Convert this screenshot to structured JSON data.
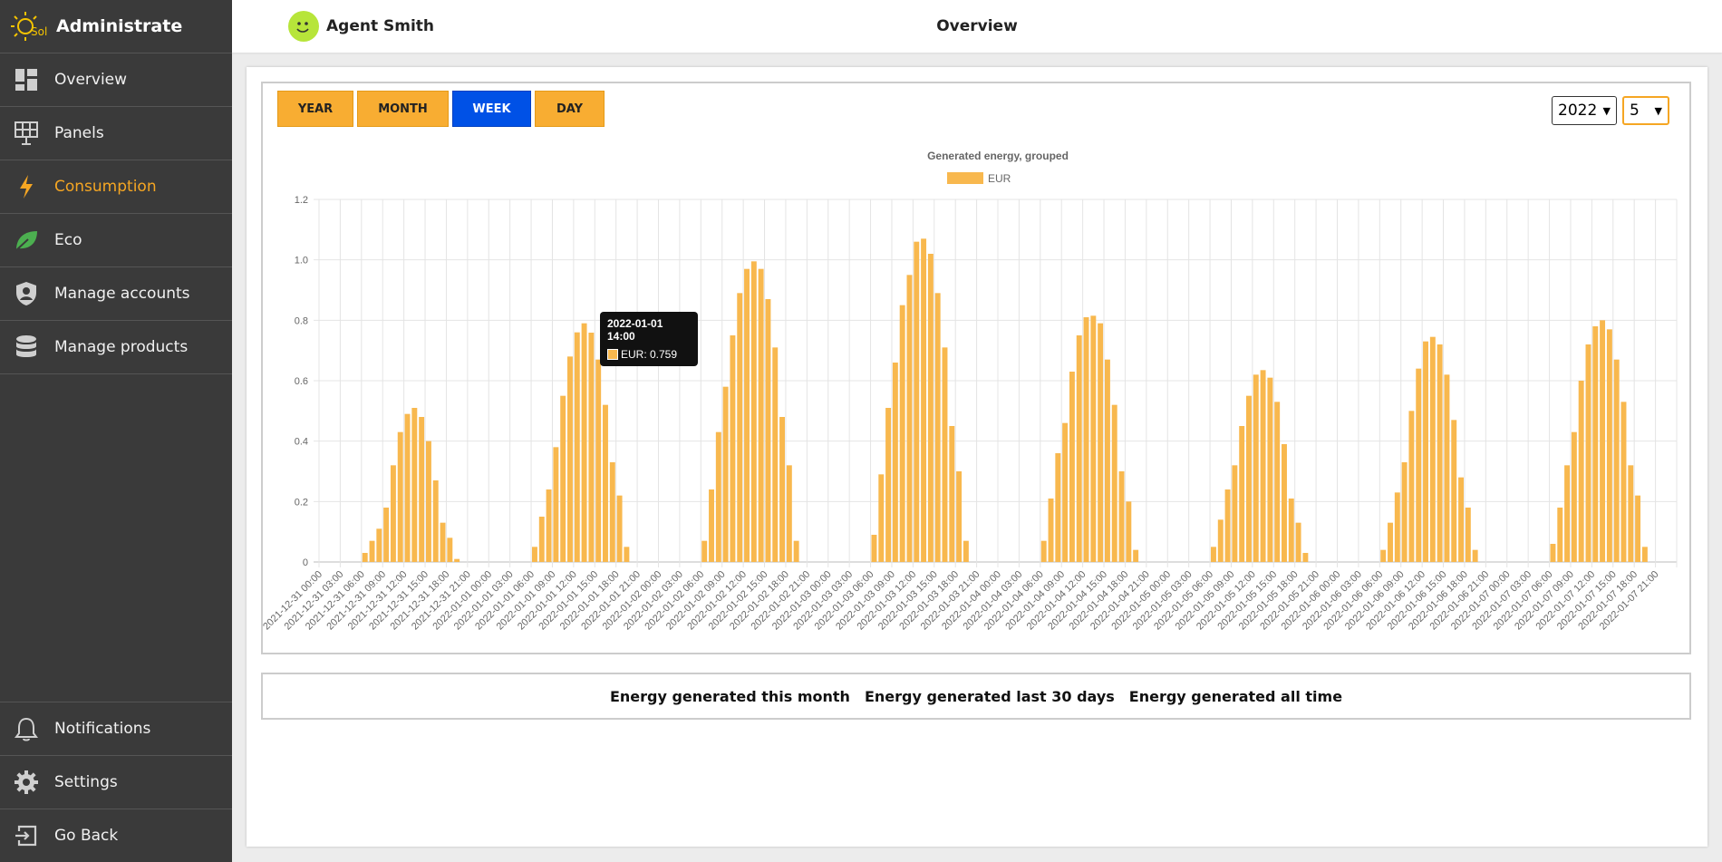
{
  "brand": {
    "name": "Administrate",
    "logo_text": "Sol"
  },
  "sidebar": {
    "items": [
      {
        "label": "Overview",
        "icon": "dashboard-icon"
      },
      {
        "label": "Panels",
        "icon": "solar-panel-icon"
      },
      {
        "label": "Consumption",
        "icon": "lightning-icon",
        "active": true
      },
      {
        "label": "Eco",
        "icon": "leaf-icon"
      },
      {
        "label": "Manage accounts",
        "icon": "shield-user-icon"
      },
      {
        "label": "Manage products",
        "icon": "database-icon"
      }
    ],
    "bottom_items": [
      {
        "label": "Notifications",
        "icon": "bell-icon"
      },
      {
        "label": "Settings",
        "icon": "gear-icon"
      },
      {
        "label": "Go Back",
        "icon": "exit-icon"
      }
    ]
  },
  "header": {
    "user_name": "Agent Smith",
    "page_title": "Overview"
  },
  "periods": [
    "YEAR",
    "MONTH",
    "WEEK",
    "DAY"
  ],
  "active_period": "WEEK",
  "year_select": "2022",
  "month_select": "5",
  "colors": {
    "accent": "#f5a623",
    "bar": "#f8b84e",
    "active_tab": "#0051e6",
    "sidebar_bg": "#3a3a3a"
  },
  "tooltip": {
    "title": "2022-01-01 14:00",
    "label": "EUR: 0.759"
  },
  "stats": [
    "Energy generated this month",
    "Energy generated last 30 days",
    "Energy generated all time"
  ],
  "chart_data": {
    "type": "bar",
    "title": "Generated energy, grouped",
    "legend": "top-center",
    "series": [
      {
        "name": "EUR",
        "values": [
          0,
          0,
          0,
          0,
          0,
          0,
          0.03,
          0.07,
          0.11,
          0.18,
          0.32,
          0.43,
          0.49,
          0.51,
          0.48,
          0.4,
          0.27,
          0.13,
          0.08,
          0.01,
          0,
          0,
          0,
          0,
          0,
          0,
          0,
          0,
          0,
          0,
          0.05,
          0.15,
          0.24,
          0.38,
          0.55,
          0.68,
          0.76,
          0.79,
          0.759,
          0.67,
          0.52,
          0.33,
          0.22,
          0.05,
          0,
          0,
          0,
          0,
          0,
          0,
          0,
          0,
          0,
          0,
          0.07,
          0.24,
          0.43,
          0.58,
          0.75,
          0.89,
          0.97,
          0.995,
          0.97,
          0.87,
          0.71,
          0.48,
          0.32,
          0.07,
          0,
          0,
          0,
          0,
          0,
          0,
          0,
          0,
          0,
          0,
          0.09,
          0.29,
          0.51,
          0.66,
          0.85,
          0.95,
          1.06,
          1.07,
          1.02,
          0.89,
          0.71,
          0.45,
          0.3,
          0.07,
          0,
          0,
          0,
          0,
          0,
          0,
          0,
          0,
          0,
          0,
          0.07,
          0.21,
          0.36,
          0.46,
          0.63,
          0.75,
          0.81,
          0.815,
          0.79,
          0.67,
          0.52,
          0.3,
          0.2,
          0.04,
          0,
          0,
          0,
          0,
          0,
          0,
          0,
          0,
          0,
          0,
          0.05,
          0.14,
          0.24,
          0.32,
          0.45,
          0.55,
          0.62,
          0.635,
          0.61,
          0.53,
          0.39,
          0.21,
          0.13,
          0.03,
          0,
          0,
          0,
          0,
          0,
          0,
          0,
          0,
          0,
          0,
          0.04,
          0.13,
          0.23,
          0.33,
          0.5,
          0.64,
          0.73,
          0.745,
          0.72,
          0.62,
          0.47,
          0.28,
          0.18,
          0.04,
          0,
          0,
          0,
          0,
          0,
          0,
          0,
          0,
          0,
          0,
          0.06,
          0.18,
          0.32,
          0.43,
          0.6,
          0.72,
          0.78,
          0.8,
          0.77,
          0.67,
          0.53,
          0.32,
          0.22,
          0.05,
          0,
          0,
          0,
          0
        ]
      }
    ],
    "x_labels": [
      "2021-12-31 00:00",
      "2021-12-31 03:00",
      "2021-12-31 06:00",
      "2021-12-31 09:00",
      "2021-12-31 12:00",
      "2021-12-31 15:00",
      "2021-12-31 18:00",
      "2021-12-31 21:00",
      "2022-01-01 00:00",
      "2022-01-01 03:00",
      "2022-01-01 06:00",
      "2022-01-01 09:00",
      "2022-01-01 12:00",
      "2022-01-01 15:00",
      "2022-01-01 18:00",
      "2022-01-01 21:00",
      "2022-01-02 00:00",
      "2022-01-02 03:00",
      "2022-01-02 06:00",
      "2022-01-02 09:00",
      "2022-01-02 12:00",
      "2022-01-02 15:00",
      "2022-01-02 18:00",
      "2022-01-02 21:00",
      "2022-01-03 00:00",
      "2022-01-03 03:00",
      "2022-01-03 06:00",
      "2022-01-03 09:00",
      "2022-01-03 12:00",
      "2022-01-03 15:00",
      "2022-01-03 18:00",
      "2022-01-03 21:00",
      "2022-01-04 00:00",
      "2022-01-04 03:00",
      "2022-01-04 06:00",
      "2022-01-04 09:00",
      "2022-01-04 12:00",
      "2022-01-04 15:00",
      "2022-01-04 18:00",
      "2022-01-04 21:00",
      "2022-01-05 00:00",
      "2022-01-05 03:00",
      "2022-01-05 06:00",
      "2022-01-05 09:00",
      "2022-01-05 12:00",
      "2022-01-05 15:00",
      "2022-01-05 18:00",
      "2022-01-05 21:00",
      "2022-01-06 00:00",
      "2022-01-06 03:00",
      "2022-01-06 06:00",
      "2022-01-06 09:00",
      "2022-01-06 12:00",
      "2022-01-06 15:00",
      "2022-01-06 18:00",
      "2022-01-06 21:00",
      "2022-01-07 00:00",
      "2022-01-07 03:00",
      "2022-01-07 06:00",
      "2022-01-07 09:00",
      "2022-01-07 12:00",
      "2022-01-07 15:00",
      "2022-01-07 18:00",
      "2022-01-07 21:00"
    ],
    "ylim": [
      0,
      1.2
    ],
    "yticks": [
      "0",
      "0.2",
      "0.4",
      "0.6",
      "0.8",
      "1.0",
      "1.2"
    ],
    "grid": true
  }
}
